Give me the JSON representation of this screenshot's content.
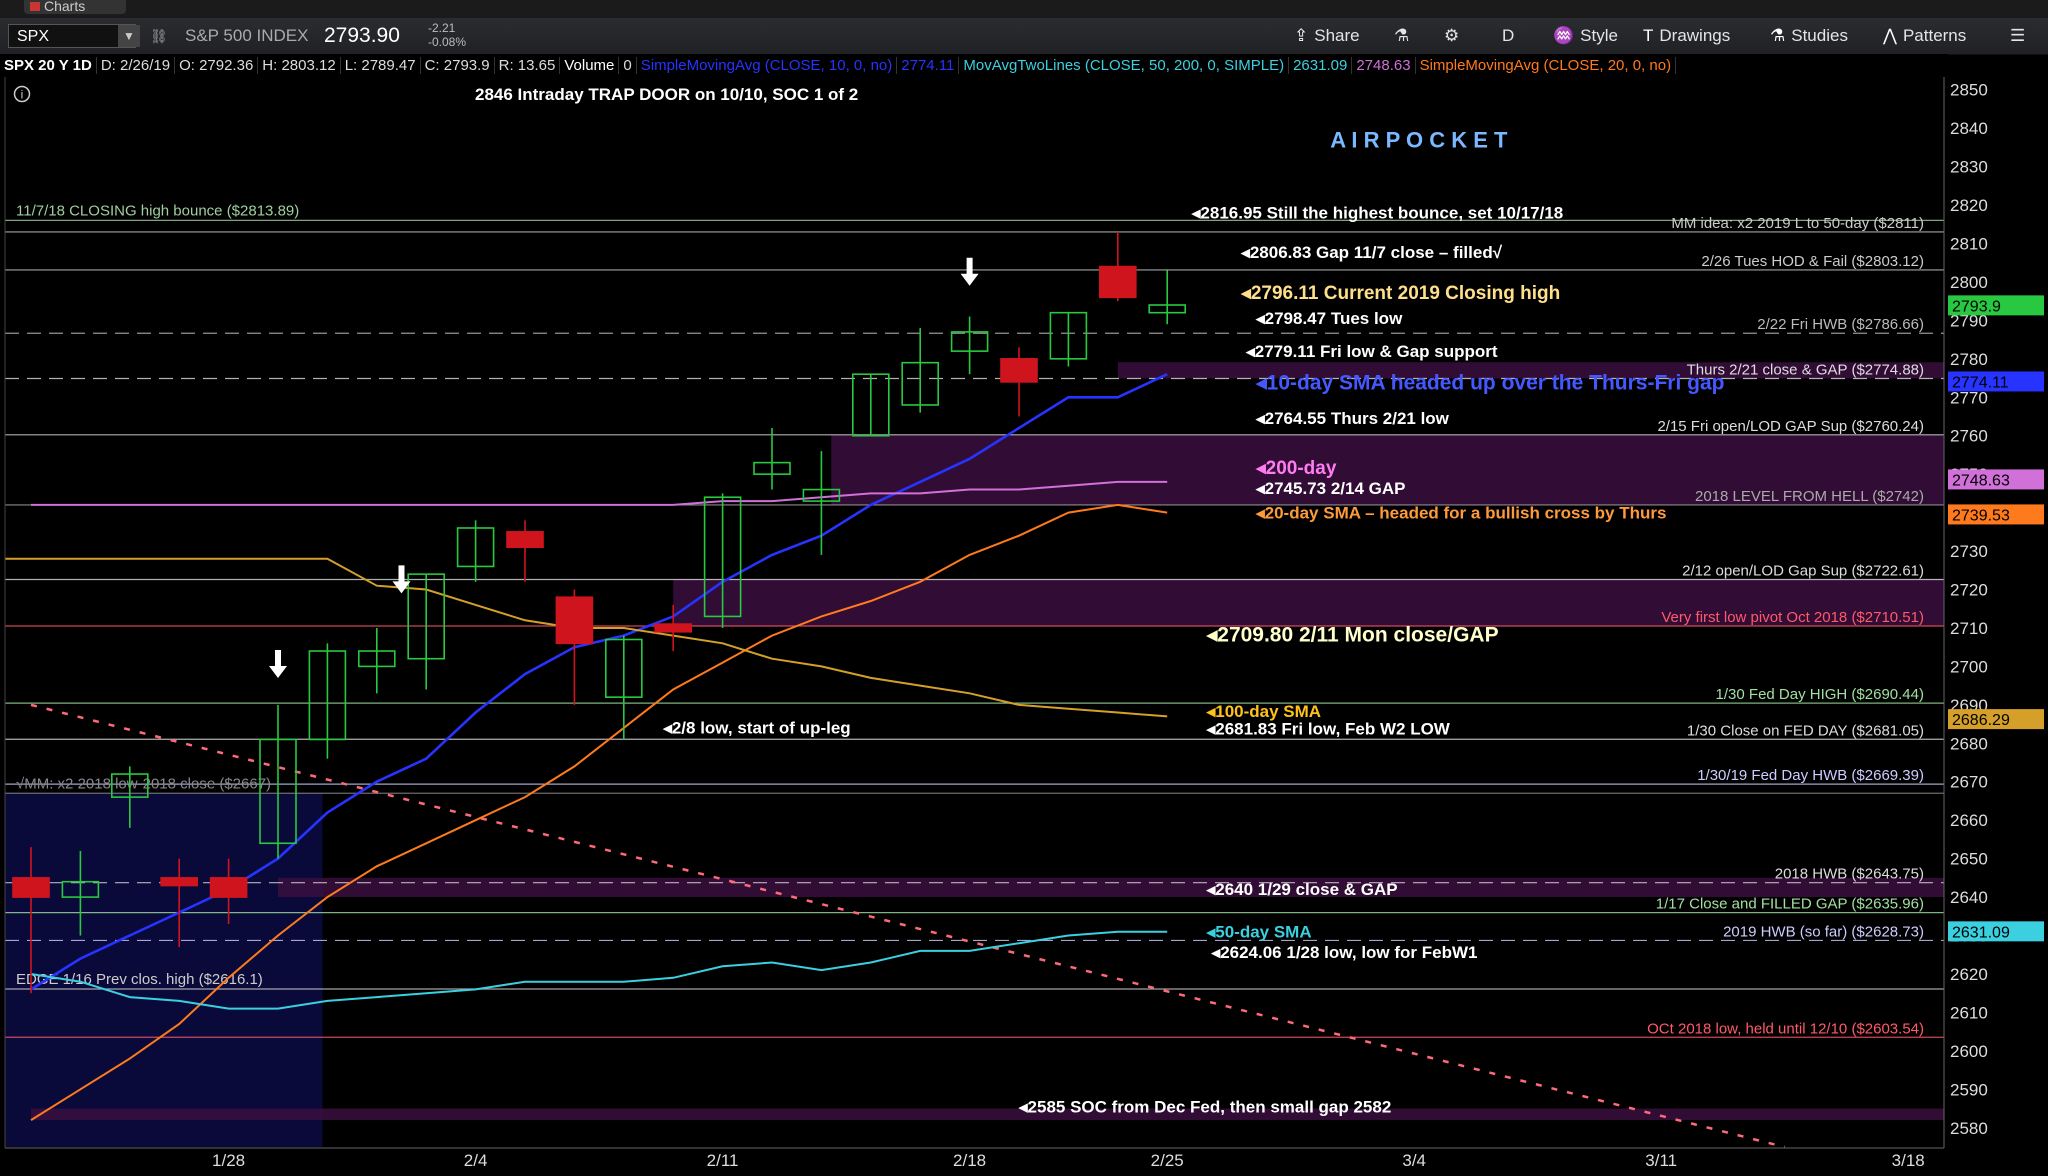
{
  "app": {
    "tab_label": "Charts"
  },
  "toolbar": {
    "symbol": "SPX",
    "index_name": "S&P 500 INDEX",
    "last": "2793.90",
    "change": "-2.21",
    "change_pct": "-0.08%",
    "share": "Share",
    "period": "D",
    "style": "Style",
    "drawings": "Drawings",
    "studies": "Studies",
    "patterns": "Patterns"
  },
  "infobar": {
    "title": "SPX 20 Y 1D",
    "date": "D: 2/26/19",
    "open": "O: 2792.36",
    "high": "H: 2803.12",
    "low": "L: 2789.47",
    "close": "C: 2793.9",
    "range": "R: 13.65",
    "volume_label": "Volume",
    "volume": "0",
    "sma10": "SimpleMovingAvg (CLOSE, 10, 0, no)",
    "sma10_val": "2774.11",
    "mavg2": "MovAvgTwoLines (CLOSE, 50, 200, 0, SIMPLE)",
    "mavg2_v1": "2631.09",
    "mavg2_v2": "2748.63",
    "sma20": "SimpleMovingAvg (CLOSE, 20, 0, no)"
  },
  "header_note": "2846 Intraday TRAP DOOR on 10/10, SOC 1 of 2",
  "colors": {
    "up": "#28c840",
    "down": "#d0141e",
    "sma10": "#2733ff",
    "sma20": "#ff7a1c",
    "sma50": "#3ad0e0",
    "sma100": "#d4a02a",
    "sma200": "#d070d8",
    "zone": "#3a0f40"
  },
  "chart_data": {
    "type": "candlestick",
    "ylim": [
      2575,
      2852
    ],
    "y_ticks": [
      2580,
      2590,
      2600,
      2610,
      2620,
      2630,
      2640,
      2650,
      2660,
      2670,
      2680,
      2690,
      2700,
      2710,
      2720,
      2730,
      2740,
      2750,
      2760,
      2770,
      2780,
      2790,
      2800,
      2810,
      2820,
      2830,
      2840,
      2850
    ],
    "x_labels": [
      {
        "label": "1/28",
        "i": 4
      },
      {
        "label": "2/4",
        "i": 9
      },
      {
        "label": "2/11",
        "i": 14
      },
      {
        "label": "2/18",
        "i": 19
      },
      {
        "label": "2/25",
        "i": 23
      },
      {
        "label": "3/4",
        "i": 28
      },
      {
        "label": "3/11",
        "i": 33
      },
      {
        "label": "3/18",
        "i": 38
      }
    ],
    "candles": [
      {
        "d": "1/22",
        "o": 2645,
        "h": 2653,
        "l": 2615,
        "c": 2640
      },
      {
        "d": "1/23",
        "o": 2640,
        "h": 2652,
        "l": 2630,
        "c": 2644
      },
      {
        "d": "1/24",
        "o": 2666,
        "h": 2674,
        "l": 2658,
        "c": 2672
      },
      {
        "d": "1/25",
        "o": 2645,
        "h": 2650,
        "l": 2627,
        "c": 2643
      },
      {
        "d": "1/28",
        "o": 2645,
        "h": 2650,
        "l": 2633,
        "c": 2640
      },
      {
        "d": "1/29",
        "o": 2654,
        "h": 2690,
        "l": 2650,
        "c": 2681
      },
      {
        "d": "1/30",
        "o": 2681,
        "h": 2706,
        "l": 2676,
        "c": 2704
      },
      {
        "d": "1/31",
        "o": 2700,
        "h": 2710,
        "l": 2693,
        "c": 2704
      },
      {
        "d": "2/1",
        "o": 2702,
        "h": 2724,
        "l": 2694,
        "c": 2724
      },
      {
        "d": "2/4",
        "o": 2726,
        "h": 2738,
        "l": 2722,
        "c": 2736
      },
      {
        "d": "2/5",
        "o": 2735,
        "h": 2738,
        "l": 2722,
        "c": 2731
      },
      {
        "d": "2/6",
        "o": 2718,
        "h": 2720,
        "l": 2690,
        "c": 2706
      },
      {
        "d": "2/7",
        "o": 2692,
        "h": 2708,
        "l": 2681,
        "c": 2707
      },
      {
        "d": "2/8",
        "o": 2711,
        "h": 2716,
        "l": 2704,
        "c": 2709
      },
      {
        "d": "2/11",
        "o": 2713,
        "h": 2745,
        "l": 2710,
        "c": 2744
      },
      {
        "d": "2/12",
        "o": 2750,
        "h": 2762,
        "l": 2746,
        "c": 2753
      },
      {
        "d": "2/13",
        "o": 2743,
        "h": 2756,
        "l": 2729,
        "c": 2746
      },
      {
        "d": "2/15",
        "o": 2760,
        "h": 2776,
        "l": 2760,
        "c": 2776
      },
      {
        "d": "2/19",
        "o": 2768,
        "h": 2788,
        "l": 2766,
        "c": 2779
      },
      {
        "d": "2/20",
        "o": 2782,
        "h": 2791,
        "l": 2776,
        "c": 2787
      },
      {
        "d": "2/21",
        "o": 2780,
        "h": 2783,
        "l": 2765,
        "c": 2774
      },
      {
        "d": "2/22",
        "o": 2780,
        "h": 2792,
        "l": 2778,
        "c": 2792
      },
      {
        "d": "2/25",
        "o": 2804,
        "h": 2813,
        "l": 2795,
        "c": 2796
      },
      {
        "d": "2/26",
        "o": 2792,
        "h": 2803,
        "l": 2789,
        "c": 2794
      }
    ],
    "series": [
      {
        "name": "10-day SMA",
        "values": [
          2616,
          2624,
          2630,
          2636,
          2642,
          2650,
          2662,
          2670,
          2676,
          2688,
          2698,
          2705,
          2708,
          2713,
          2722,
          2729,
          2734,
          2742,
          2748,
          2754,
          2762,
          2770,
          2770,
          2776
        ]
      },
      {
        "name": "20-day SMA",
        "values": [
          2582,
          2590,
          2598,
          2607,
          2619,
          2630,
          2640,
          2648,
          2654,
          2660,
          2666,
          2674,
          2684,
          2694,
          2701,
          2708,
          2713,
          2717,
          2722,
          2729,
          2734,
          2740,
          2742,
          2740
        ]
      },
      {
        "name": "50-day SMA",
        "values": [
          2620,
          2618,
          2614,
          2613,
          2611,
          2611,
          2613,
          2614,
          2615,
          2616,
          2618,
          2618,
          2618,
          2619,
          2622,
          2623,
          2621,
          2623,
          2626,
          2626,
          2628,
          2630,
          2631,
          2631
        ]
      },
      {
        "name": "100-day SMA",
        "values": [
          2728,
          2721,
          2720,
          2716,
          2712,
          2710,
          2710,
          2708,
          2706,
          2702,
          2700,
          2697,
          2695,
          2693,
          2690,
          2689,
          2688,
          2687
        ]
      },
      {
        "name": "200-day SMA",
        "values": [
          2742,
          2742,
          2742,
          2742,
          2742,
          2742,
          2742,
          2742,
          2742,
          2742,
          2742,
          2742,
          2742,
          2742,
          2743,
          2743,
          2744,
          2745,
          2745,
          2746,
          2746,
          2747,
          2748,
          2748
        ]
      }
    ],
    "price_tags": [
      {
        "v": 2793.9,
        "text": "2793.9",
        "color": "#28c840"
      },
      {
        "v": 2774.11,
        "text": "2774.11",
        "color": "#2733ff"
      },
      {
        "v": 2748.63,
        "text": "2748.63",
        "color": "#d070d8"
      },
      {
        "v": 2739.53,
        "text": "2739.53",
        "color": "#ff7a1c"
      },
      {
        "v": 2686.29,
        "text": "2686.29",
        "color": "#d4a02a"
      },
      {
        "v": 2631.09,
        "text": "2631.09",
        "color": "#3ad0e0"
      }
    ],
    "hlines": [
      {
        "v": 2816,
        "color": "#9fcf9f",
        "dash": false,
        "label": "11/7/18 CLOSING high bounce ($2813.89)",
        "side": "left"
      },
      {
        "v": 2813,
        "color": "#cccccc",
        "dash": false,
        "label": "MM idea: x2 2019 L to 50-day ($2811)",
        "side": "right"
      },
      {
        "v": 2803.12,
        "color": "#cccccc",
        "dash": false,
        "label": "2/26 Tues HOD & Fail ($2803.12)",
        "side": "right"
      },
      {
        "v": 2786.66,
        "color": "#bbbbbb",
        "dash": true,
        "label": "2/22 Fri HWB ($2786.66)",
        "side": "right"
      },
      {
        "v": 2774.88,
        "color": "#dddddd",
        "dash": true,
        "label": "Thurs 2/21 close & GAP ($2774.88)",
        "side": "right"
      },
      {
        "v": 2760.24,
        "color": "#dddddd",
        "dash": false,
        "label": "2/15 Fri open/LOD GAP Sup ($2760.24)",
        "side": "right"
      },
      {
        "v": 2742,
        "color": "#aaaaaa",
        "dash": false,
        "label": "2018 LEVEL FROM HELL ($2742)",
        "side": "right"
      },
      {
        "v": 2722.61,
        "color": "#dddddd",
        "dash": false,
        "label": "2/12 open/LOD Gap Sup ($2722.61)",
        "side": "right"
      },
      {
        "v": 2710.51,
        "color": "#ff5a6a",
        "dash": false,
        "label": "Very first low pivot Oct 2018  ($2710.51)",
        "side": "right"
      },
      {
        "v": 2690.44,
        "color": "#a0e0a0",
        "dash": false,
        "label": "1/30 Fed Day HIGH ($2690.44)",
        "side": "right"
      },
      {
        "v": 2681.05,
        "color": "#dddddd",
        "dash": false,
        "label": "1/30  Close on FED DAY ($2681.05)",
        "side": "right"
      },
      {
        "v": 2669.39,
        "color": "#ccccff",
        "dash": false,
        "label": "1/30/19 Fed Day HWB ($2669.39)",
        "side": "right"
      },
      {
        "v": 2667,
        "color": "#888888",
        "dash": false,
        "label": "√MM: x2 2018 low-2018 close ($2667)",
        "side": "left"
      },
      {
        "v": 2643.75,
        "color": "#dddddd",
        "dash": true,
        "label": "2018 HWB  ($2643.75)",
        "side": "right"
      },
      {
        "v": 2635.96,
        "color": "#a0e0a0",
        "dash": false,
        "label": "1/17 Close and FILLED  GAP ($2635.96)",
        "side": "right"
      },
      {
        "v": 2628.73,
        "color": "#ccccff",
        "dash": true,
        "label": "2019 HWB (so far) ($2628.73)",
        "side": "right"
      },
      {
        "v": 2616.1,
        "color": "#cccccc",
        "dash": false,
        "label": "EDGE 1/16 Prev clos. high  ($2616.1)",
        "side": "left"
      },
      {
        "v": 2603.54,
        "color": "#ff5a6a",
        "dash": false,
        "label": "OCt 2018 low, held until 12/10 ($2603.54)",
        "side": "right"
      }
    ],
    "zones": [
      {
        "from": 2774.88,
        "to": 2779.11,
        "start": 22,
        "color": "#3a0f40"
      },
      {
        "from": 2742,
        "to": 2760.24,
        "start": 16.2,
        "color": "#3a0f40"
      },
      {
        "from": 2710.51,
        "to": 2722.61,
        "start": 13,
        "color": "#3a0f40"
      },
      {
        "from": 2640,
        "to": 2645,
        "start": 5,
        "color": "#3a0f40"
      },
      {
        "from": 2582,
        "to": 2585,
        "start": 0,
        "color": "#3a0f40"
      }
    ],
    "blue_box": {
      "from": 2575,
      "to": 2667,
      "end": 5.9
    },
    "annotations": [
      {
        "text": "A I R   P O C K E T",
        "v": 2835,
        "i": 26.3,
        "color": "#7ab8ff",
        "size": 22
      },
      {
        "text": "◂2816.95 Still the highest bounce, set 10/17/18",
        "v": 2816.5,
        "i": 23.5,
        "color": "#ffffff",
        "size": 17
      },
      {
        "text": "◂2806.83 Gap 11/7 close – filled√",
        "v": 2806.2,
        "i": 24.5,
        "color": "#ffffff",
        "size": 17
      },
      {
        "text": "◂2796.11 Current 2019 Closing high",
        "v": 2795.5,
        "i": 24.5,
        "color": "#ffe08a",
        "size": 19
      },
      {
        "text": "◂2798.47 Tues low",
        "v": 2789,
        "i": 24.8,
        "color": "#ffffff",
        "size": 17
      },
      {
        "text": "◂2779.11 Fri low & Gap support",
        "v": 2780.5,
        "i": 24.6,
        "color": "#ffffff",
        "size": 17
      },
      {
        "text": "◂10-day SMA headed up over the Thurs-Fri gap",
        "v": 2772,
        "i": 24.8,
        "color": "#4458ff",
        "size": 21
      },
      {
        "text": "◂2764.55 Thurs 2/21 low",
        "v": 2763,
        "i": 24.8,
        "color": "#ffffff",
        "size": 17
      },
      {
        "text": "◂200-day",
        "v": 2750,
        "i": 24.8,
        "color": "#ff7cf0",
        "size": 19
      },
      {
        "text": "◂2745.73 2/14 GAP",
        "v": 2744.8,
        "i": 24.8,
        "color": "#ffffff",
        "size": 17
      },
      {
        "text": "◂20-day SMA – headed for a bullish cross by Thurs",
        "v": 2738.5,
        "i": 24.8,
        "color": "#ff9a3a",
        "size": 17
      },
      {
        "text": "◂2709.80 2/11 Mon close/GAP",
        "v": 2706.5,
        "i": 23.8,
        "color": "#ffffcc",
        "size": 21
      },
      {
        "text": "◂100-day SMA",
        "v": 2686.8,
        "i": 23.8,
        "color": "#ffc21a",
        "size": 17
      },
      {
        "text": "◂2681.83 Fri low, Feb W2 LOW",
        "v": 2682.3,
        "i": 23.8,
        "color": "#ffffff",
        "size": 17
      },
      {
        "text": "◂2/8 low, start of up-leg",
        "v": 2682.5,
        "i": 12.8,
        "color": "#ffffff",
        "size": 17
      },
      {
        "text": "◂2640 1/29 close & GAP",
        "v": 2640.5,
        "i": 23.8,
        "color": "#ffffff",
        "size": 17
      },
      {
        "text": "◂50-day SMA",
        "v": 2629.5,
        "i": 23.8,
        "color": "#3ad0e0",
        "size": 17
      },
      {
        "text": "◂2624.06 1/28 low, low for FebW1",
        "v": 2624.2,
        "i": 23.9,
        "color": "#ffffff",
        "size": 17
      },
      {
        "text": "◂2585 SOC from Dec Fed, then small gap 2582",
        "v": 2584,
        "i": 20,
        "color": "#ffffff",
        "size": 17
      }
    ],
    "arrows": [
      {
        "i": 5,
        "v": 2697
      },
      {
        "i": 7.5,
        "v": 2719
      },
      {
        "i": 19,
        "v": 2799
      }
    ],
    "trendline": {
      "i0": 0,
      "v0": 2690,
      "i1": 35.5,
      "v1": 2575
    }
  }
}
